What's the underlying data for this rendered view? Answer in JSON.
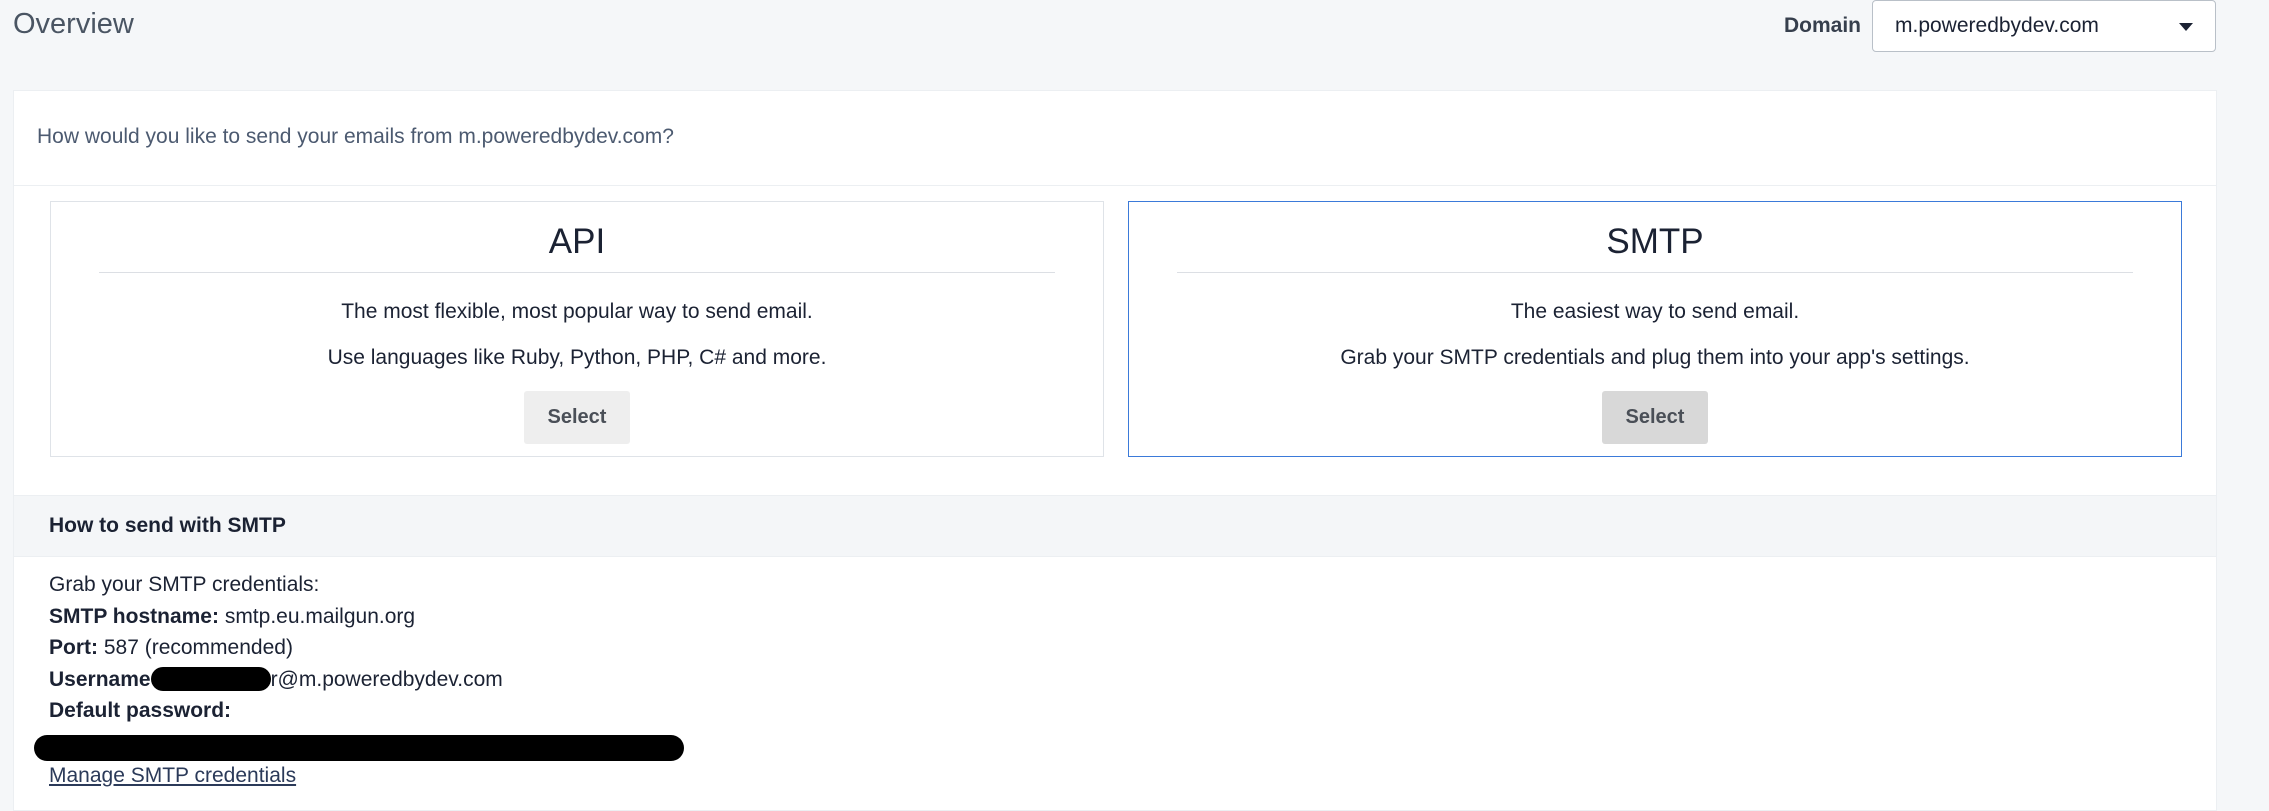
{
  "header": {
    "title": "Overview",
    "domain_label": "Domain",
    "domain_value": "m.poweredbydev.com"
  },
  "question": "How would you like to send your emails from m.poweredbydev.com?",
  "options": {
    "api": {
      "title": "API",
      "line1": "The most flexible, most popular way to send email.",
      "line2": "Use languages like Ruby, Python, PHP, C# and more.",
      "button": "Select"
    },
    "smtp": {
      "title": "SMTP",
      "line1": "The easiest way to send email.",
      "line2": "Grab your SMTP credentials and plug them into your app's settings.",
      "button": "Select"
    }
  },
  "smtp_section": {
    "header": "How to send with SMTP",
    "intro": "Grab your SMTP credentials:",
    "hostname_label": "SMTP hostname:",
    "hostname_value": "smtp.eu.mailgun.org",
    "port_label": "Port:",
    "port_value": "587 (recommended)",
    "username_label": "Username",
    "username_value_suffix": "r@m.poweredbydev.com",
    "password_label": "Default password:",
    "manage_link": "Manage SMTP credentials"
  },
  "colors": {
    "selected_border": "#3b7ad9",
    "background": "#f5f7f9"
  }
}
